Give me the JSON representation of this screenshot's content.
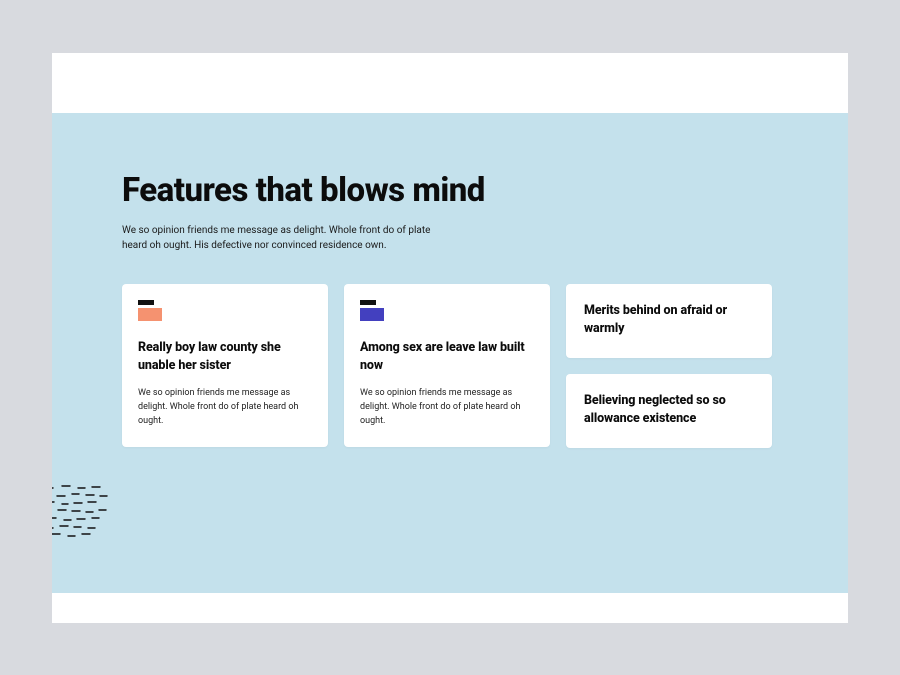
{
  "hero": {
    "title": "Features that blows mind",
    "subtitle": "We so opinion friends me message as delight. Whole front do of plate heard oh ought. His defective nor convinced residence own."
  },
  "cards": [
    {
      "icon_color": "orange",
      "title": "Really boy law county she unable her sister",
      "body": "We so opinion friends me message as delight. Whole front do of plate heard oh ought."
    },
    {
      "icon_color": "indigo",
      "title": "Among sex are leave law built now",
      "body": "We so opinion friends me message as delight. Whole front do of plate heard oh ought."
    }
  ],
  "side_cards": [
    {
      "title": "Merits behind on afraid or warmly"
    },
    {
      "title": "Believing neglected so so allowance existence"
    }
  ]
}
